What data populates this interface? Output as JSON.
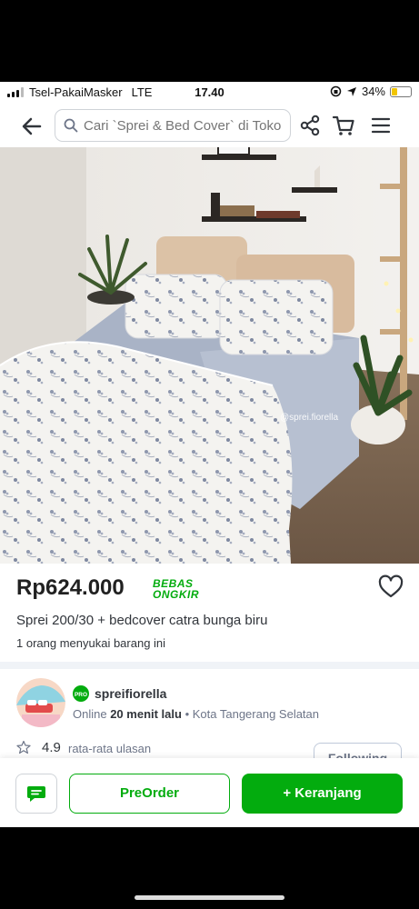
{
  "status_bar": {
    "carrier": "Tsel-PakaiMasker",
    "network": "LTE",
    "time": "17.40",
    "battery": "34%",
    "battery_level": 0.34
  },
  "header": {
    "search_placeholder": "Cari `Sprei & Bed Cover` di Toko"
  },
  "product": {
    "watermark": "@sprei.fiorella",
    "price": "Rp624.000",
    "ongkir_line1": "BEBAS",
    "ongkir_line2": "ONGKIR",
    "title": "Sprei 200/30 + bedcover catra bunga biru",
    "likes": "1 orang menyukai barang ini"
  },
  "shop": {
    "name": "spreifiorella",
    "online_prefix": "Online",
    "online_time": "20 menit lalu",
    "location": "• Kota Tangerang Selatan",
    "rating": "4.9",
    "rating_label": "rata-rata ulasan",
    "follow_label": "Following"
  },
  "bottom_bar": {
    "preorder_label": "PreOrder",
    "cart_label": "+ Keranjang"
  },
  "colors": {
    "accent_green": "#03ac0e",
    "battery_yellow": "#f2c500"
  }
}
